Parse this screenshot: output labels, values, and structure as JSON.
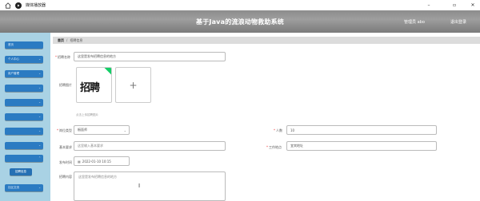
{
  "titlebar": {
    "app_title": "媒体播放器"
  },
  "header": {
    "system_title": "基于Java的流浪动物救助系统",
    "admin_label": "管理员 abo",
    "logout_label": "退出登录"
  },
  "sidebar": {
    "items": [
      "首页",
      "个人中心",
      "用户管理",
      "",
      "",
      "",
      "",
      "",
      "",
      "",
      ""
    ],
    "active_sub": "招聘信息",
    "last_item": "社区交流"
  },
  "breadcrumb": {
    "home": "首页",
    "current": "招聘信息"
  },
  "form": {
    "title_label": "招聘名称",
    "title_value": "这里是发布招聘信息的地方",
    "image_label": "招聘图片",
    "image_glyph": "招聘",
    "add_icon": "plus-icon",
    "image_hint": "点击上传招聘图片",
    "job_type_label": "岗位类型",
    "job_type_value": "橱面师",
    "headcount_label": "人数",
    "headcount_value": "10",
    "requirement_label": "基本要求",
    "requirement_placeholder": "这里输入基本要求",
    "location_label": "工作地点",
    "location_value": "宜宾地址",
    "publish_time_label": "发布时间",
    "publish_time_value": "2022-01-10 10:15",
    "content_label": "招聘内容",
    "content_value": "这里是发布招聘信息的地方"
  },
  "colors": {
    "sidebar_bg": "#a9d2e4",
    "menu_blue": "#2b7bc2",
    "header_gray": "#8c8c8c",
    "upload_badge": "#13ce66"
  }
}
